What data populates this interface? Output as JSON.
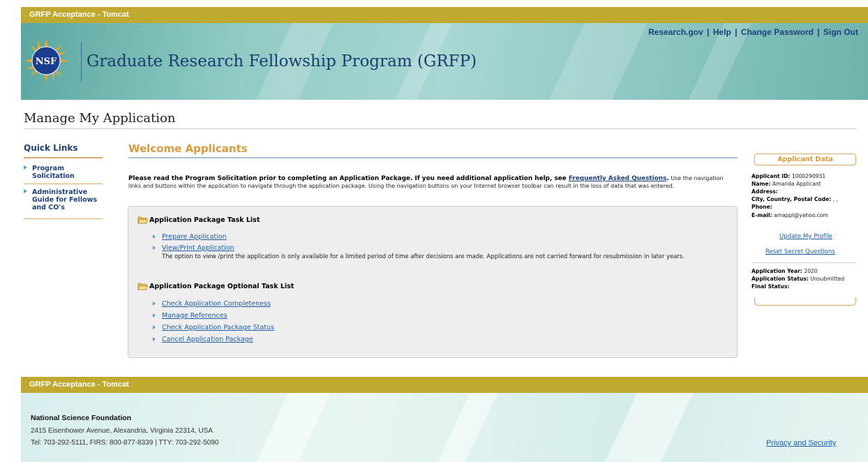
{
  "env_label": "GRFP Acceptance - Tomcat",
  "header": {
    "app_title": "Graduate Research Fellowship Program (GRFP)",
    "logo_text": "NSF",
    "links": {
      "research_gov": "Research.gov",
      "help": "Help",
      "change_password": "Change Password",
      "sign_out": "Sign Out",
      "separator": "|"
    }
  },
  "page_title": "Manage My Application",
  "quick_links": {
    "title": "Quick Links",
    "items": [
      {
        "line1": "Program",
        "line2": "Solicitation",
        "line3": ""
      },
      {
        "line1": "Administrative",
        "line2": "Guide for Fellows",
        "line3": "and CO's"
      }
    ]
  },
  "main": {
    "welcome": "Welcome Applicants",
    "intro_bold": "Please read the Program Solicitation prior to completing an Application Package. If you need additional application help, see ",
    "intro_faq_link": "Frequently Asked Questions",
    "intro_bold_end": ".",
    "intro_rest": " Use the navigation links and buttons within the application to navigate through the application package. Using the navigation buttons on your Internet browser toolbar can result in the loss of data that was entered.",
    "task_list": {
      "heading": "Application Package Task List",
      "items": [
        "Prepare Application",
        "View/Print Application"
      ],
      "note": "The option to view /print the application is only available for a limited period of time after decisions are made. Applications are not carried forward for resubmission in later years."
    },
    "optional_task_list": {
      "heading": "Application Package Optional Task List",
      "items": [
        "Check Application Completeness",
        "Manage References",
        "Check Application Package Status",
        "Cancel Application Package"
      ]
    }
  },
  "applicant_data": {
    "title": "Applicant Data",
    "id_label": "Applicant ID:",
    "id_value": "1000290931",
    "name_label": "Name:",
    "name_value": "Amanda Applicant",
    "address_label": "Address:",
    "city_label": "City, Country, Postal Code:",
    "city_value": ", ,",
    "phone_label": "Phone:",
    "email_label": "E-mail:",
    "email_value": "amappl@yahoo.com",
    "update_profile": "Update My Profile",
    "reset_questions": "Reset Secret Questions",
    "year_label": "Application Year:",
    "year_value": "2020",
    "status_label": "Application Status:",
    "status_value": "Unsubmitted",
    "final_status_label": "Final Status:"
  },
  "footer": {
    "org": "National Science Foundation",
    "address": "2415 Eisenhower Avenue, Alexandria, Virginia 22314, USA",
    "tel": "Tel: 703-292-5111, FIRS: 800-877-8339 | TTY: 703-292-5090",
    "privacy": "Privacy and Security"
  },
  "colors": {
    "env_bar": "#bfaa2f",
    "brand_blue": "#1d3f7a",
    "accent_orange": "#d99a3b",
    "link_blue": "#1d5fa0"
  }
}
